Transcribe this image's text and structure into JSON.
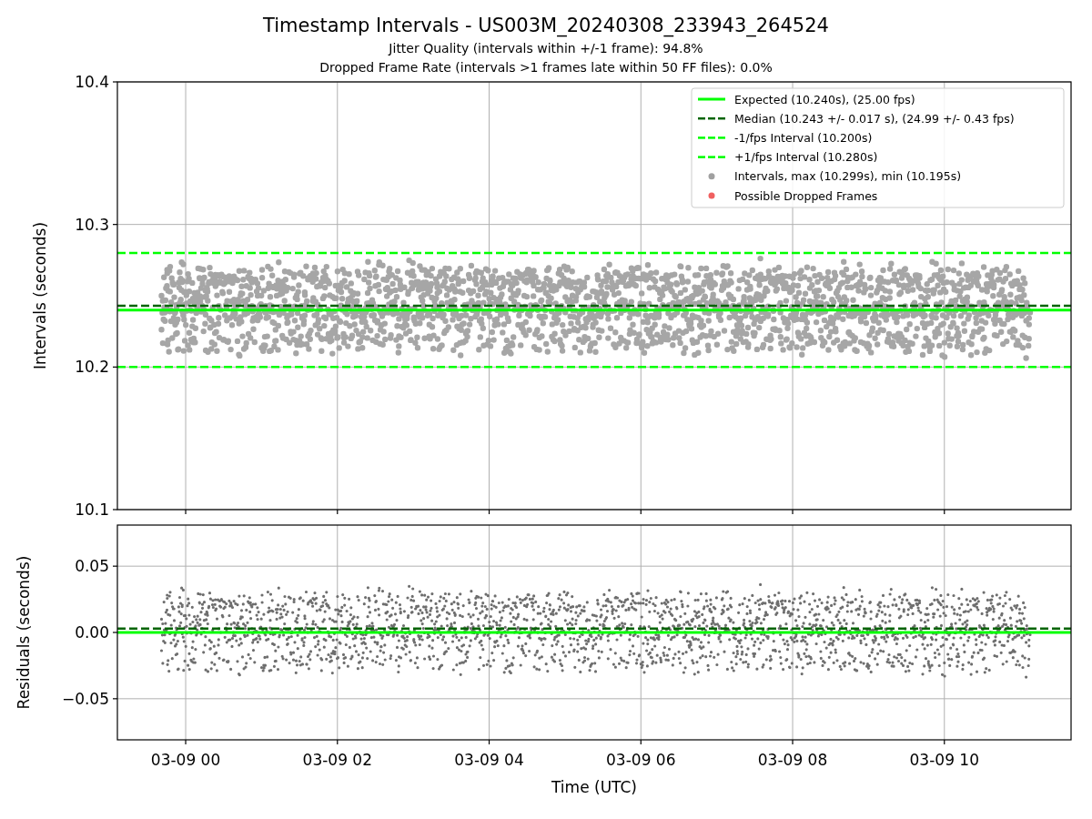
{
  "figure": {
    "title": "Timestamp Intervals - US003M_20240308_233943_264524",
    "subtitles": [
      "Jitter Quality (intervals within +/-1 frame): 94.8%",
      "Dropped Frame Rate (intervals >1 frames late within 50 FF files): 0.0%"
    ]
  },
  "charts": [
    {
      "legend": [
        {
          "label": "Expected (10.240s), (25.00 fps)",
          "kind": "solid",
          "color": "#00ff00"
        },
        {
          "label": "Median (10.243 +/- 0.017 s), (24.99 +/- 0.43 fps)",
          "kind": "dashed",
          "color": "#006400"
        },
        {
          "label": "-1/fps Interval (10.200s)",
          "kind": "dashed",
          "color": "#00ff00"
        },
        {
          "label": "+1/fps Interval (10.280s)",
          "kind": "dashed",
          "color": "#00ff00"
        },
        {
          "label": "Intervals, max (10.299s), min (10.195s)",
          "kind": "marker",
          "color": "#a0a0a0"
        },
        {
          "label": "Possible Dropped Frames",
          "kind": "marker",
          "color": "#f06060"
        }
      ],
      "chart_data": {
        "type": "scatter",
        "grid": true,
        "ylabel": "Intervals (seconds)",
        "categories": [
          null,
          null,
          null,
          null,
          null,
          null
        ],
        "ylim": [
          10.1,
          10.4
        ],
        "yticks": [
          {
            "value": 10.1,
            "label": "10.1"
          },
          {
            "value": 10.2,
            "label": "10.2"
          },
          {
            "value": 10.3,
            "label": "10.3"
          },
          {
            "value": 10.4,
            "label": "10.4"
          }
        ],
        "ref_lines": [
          {
            "axis": "y",
            "value": 10.24,
            "color": "#00ff00"
          },
          {
            "axis": "y",
            "value": 10.243,
            "color": "#006400"
          },
          {
            "axis": "y",
            "value": 10.2,
            "color": "#00ff00"
          },
          {
            "axis": "y",
            "value": 10.28,
            "color": "#00ff00"
          }
        ]
      }
    },
    {
      "chart_data": {
        "type": "scatter",
        "grid": true,
        "xlabel": "Time (UTC)",
        "ylabel": "Residuals (seconds)",
        "ylim": [
          -0.081,
          0.081
        ],
        "categories": [
          "03-09 00",
          "03-09 02",
          "03-09 04",
          "03-09 06",
          "03-09 08",
          "03-09 10"
        ],
        "yticks": [
          {
            "value": -0.05,
            "label": "−0.05"
          },
          {
            "value": 0,
            "label": "0.00"
          },
          {
            "value": 0.05,
            "label": "0.05"
          }
        ],
        "ref_lines": [
          {
            "axis": "y",
            "value": 0,
            "color": "#00ff00"
          },
          {
            "axis": "y",
            "value": 0.003,
            "color": "#006400"
          }
        ]
      }
    }
  ]
}
